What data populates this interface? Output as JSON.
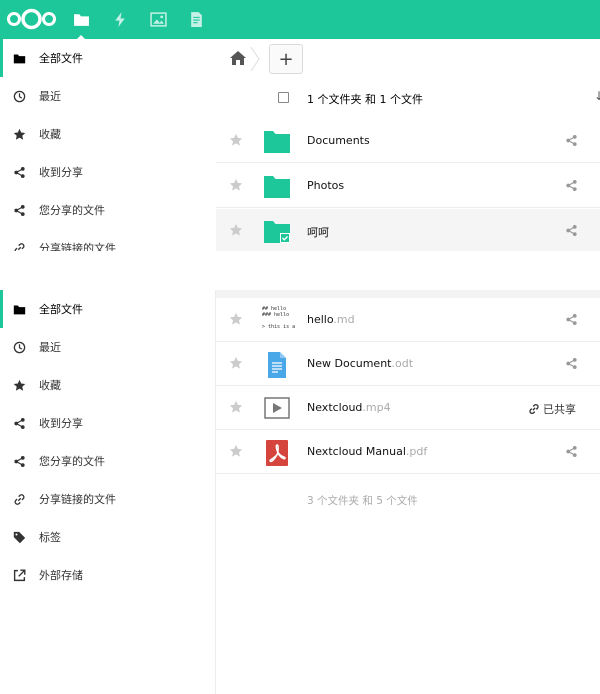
{
  "colors": {
    "brand": "#1ec79a",
    "folder": "#1ec79a",
    "doc_blue": "#4aa7e8",
    "pdf_red": "#d6453d"
  },
  "header": {
    "apps": [
      {
        "name": "files",
        "icon": "folder-icon",
        "active": true
      },
      {
        "name": "activity",
        "icon": "lightning-icon"
      },
      {
        "name": "gallery",
        "icon": "image-icon"
      },
      {
        "name": "notes",
        "icon": "document-icon"
      }
    ]
  },
  "sidebar_top": {
    "items": [
      {
        "label": "全部文件",
        "icon": "folder-icon"
      },
      {
        "label": "最近",
        "icon": "clock-icon"
      },
      {
        "label": "收藏",
        "icon": "star-icon"
      },
      {
        "label": "收到分享",
        "icon": "share-icon"
      },
      {
        "label": "您分享的文件",
        "icon": "share-icon"
      },
      {
        "label": "分享链接的文件",
        "icon": "link-icon"
      }
    ]
  },
  "sidebar_bottom": {
    "items": [
      {
        "label": "全部文件",
        "icon": "folder-icon"
      },
      {
        "label": "最近",
        "icon": "clock-icon"
      },
      {
        "label": "收藏",
        "icon": "star-icon"
      },
      {
        "label": "收到分享",
        "icon": "share-icon"
      },
      {
        "label": "您分享的文件",
        "icon": "share-icon"
      },
      {
        "label": "分享链接的文件",
        "icon": "link-icon"
      },
      {
        "label": "标签",
        "icon": "tag-icon"
      },
      {
        "label": "外部存储",
        "icon": "external-icon"
      }
    ]
  },
  "toolbar": {
    "add_label": "+"
  },
  "list_header": {
    "summary": "1 个文件夹 和 1 个文件",
    "sort": "↓"
  },
  "files_top": [
    {
      "name": "Documents",
      "ext": "",
      "type": "folder"
    },
    {
      "name": "Photos",
      "ext": "",
      "type": "folder"
    },
    {
      "name": "呵呵",
      "ext": "",
      "type": "folder-shared"
    }
  ],
  "files_bottom": [
    {
      "name": "hello",
      "ext": ".md",
      "type": "markdown",
      "preview": "## hello\n### hello\n\n> this is a t"
    },
    {
      "name": "New Document",
      "ext": ".odt",
      "type": "document"
    },
    {
      "name": "Nextcloud",
      "ext": ".mp4",
      "type": "video",
      "shared_label": "已共享"
    },
    {
      "name": "Nextcloud Manual",
      "ext": ".pdf",
      "type": "pdf"
    }
  ],
  "footer": {
    "summary": "3 个文件夹 和 5 个文件"
  }
}
